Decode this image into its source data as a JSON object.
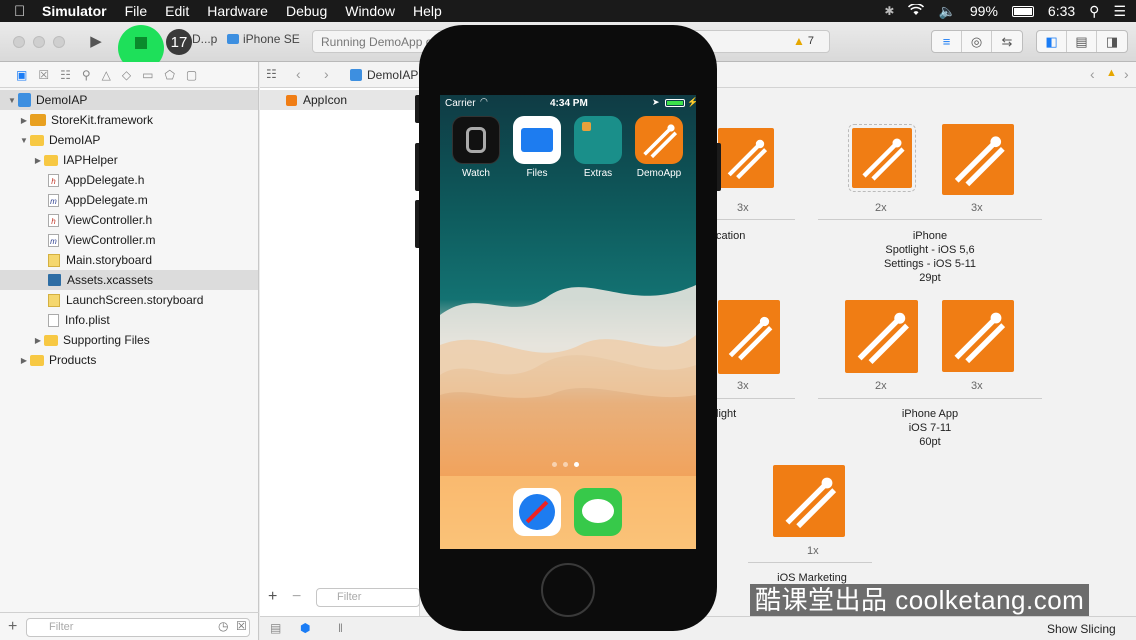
{
  "menubar": {
    "app": "Simulator",
    "items": [
      "File",
      "Edit",
      "Hardware",
      "Debug",
      "Window",
      "Help"
    ],
    "battery": "99%",
    "time": "6:33"
  },
  "toolbar": {
    "badge": "17",
    "scheme": "D...p",
    "device": "iPhone SE",
    "status": "Running DemoApp o",
    "warnings": "7"
  },
  "navigator": {
    "filter_placeholder": "Filter",
    "tree": [
      {
        "label": "DemoIAP",
        "level": 0
      },
      {
        "label": "StoreKit.framework",
        "level": 1
      },
      {
        "label": "DemoIAP",
        "level": 1
      },
      {
        "label": "IAPHelper",
        "level": 2
      },
      {
        "label": "AppDelegate.h",
        "level": 2
      },
      {
        "label": "AppDelegate.m",
        "level": 2
      },
      {
        "label": "ViewController.h",
        "level": 2
      },
      {
        "label": "ViewController.m",
        "level": 2
      },
      {
        "label": "Main.storyboard",
        "level": 2
      },
      {
        "label": "Assets.xcassets",
        "level": 2
      },
      {
        "label": "LaunchScreen.storyboard",
        "level": 2
      },
      {
        "label": "Info.plist",
        "level": 2
      },
      {
        "label": "Supporting Files",
        "level": 2
      },
      {
        "label": "Products",
        "level": 1
      }
    ]
  },
  "editor": {
    "jump_project": "DemoIAP",
    "asset_item": "AppIcon",
    "filter_placeholder": "Filter",
    "show_slicing": "Show Slicing",
    "scales": {
      "s1": "3x",
      "s2": "2x",
      "s3": "3x",
      "s4": "3x",
      "s5": "2x",
      "s6": "3x",
      "s7": "1x"
    },
    "desc_spotlight": [
      "iPhone",
      "Spotlight - iOS 5,6",
      "Settings - iOS 5-11",
      "29pt"
    ],
    "desc_partial_1": "cation",
    "desc_partial_2": "light",
    "desc_app": [
      "iPhone App",
      "iOS 7-11",
      "60pt"
    ],
    "desc_marketing": "iOS Marketing"
  },
  "simulator": {
    "carrier": "Carrier",
    "time": "4:34 PM",
    "apps": [
      "Watch",
      "Files",
      "Extras",
      "DemoApp"
    ]
  },
  "watermark": "酷课堂出品 coolketang.com"
}
